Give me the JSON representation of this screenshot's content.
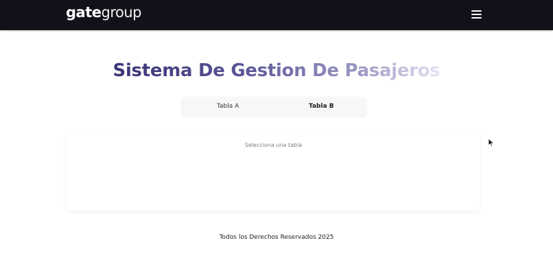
{
  "navbar": {
    "logo_bold": "gate",
    "logo_light": "group",
    "menu_icon": "hamburger-menu-icon"
  },
  "page": {
    "title": "Sistema De Gestion De Pasajeros"
  },
  "tabs": [
    {
      "label": "Tabla A",
      "active": false
    },
    {
      "label": "Tabla B",
      "active": true
    }
  ],
  "content": {
    "placeholder": "Selecciona una tabla"
  },
  "footer": {
    "text": "Todos los Derechos Reservados 2025"
  },
  "colors": {
    "navbar_bg": "#12111a",
    "title_start": "#3a3477",
    "title_end": "#e4e3f1",
    "tabs_bg": "#f7f7f8"
  }
}
